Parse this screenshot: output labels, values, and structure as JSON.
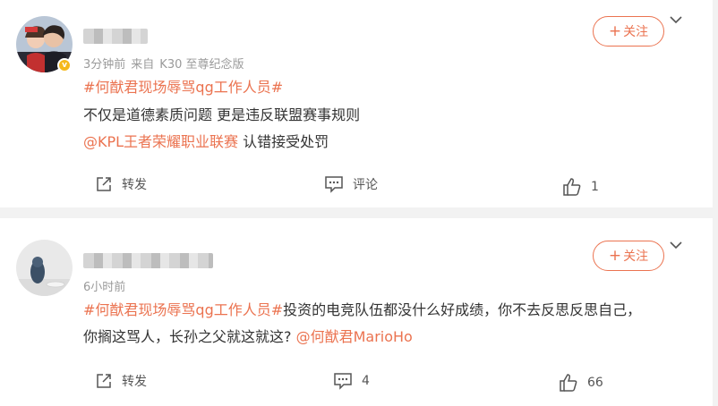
{
  "colors": {
    "accent": "#eb7350",
    "meta": "#9a9a9a",
    "text": "#333333",
    "bg": "#f2f2f2"
  },
  "comments": [
    {
      "follow_label": "关注",
      "follow_plus": "+",
      "time": "3分钟前",
      "source_prefix": "来自",
      "source_device": "K30 至尊纪念版",
      "verified_badge": "v",
      "lines": [
        {
          "hashtag": "#何猷君现场辱骂qg工作人员#",
          "text": "",
          "mention": ""
        },
        {
          "hashtag": "",
          "text": "不仅是道德素质问题 更是违反联盟赛事规则",
          "mention": ""
        },
        {
          "mention": "@KPL王者荣耀职业联赛",
          "text": " 认错接受处罚"
        }
      ],
      "actions": {
        "repost": "转发",
        "comment": "评论",
        "like": "1"
      }
    },
    {
      "follow_label": "关注",
      "follow_plus": "+",
      "time": "6小时前",
      "lines": [
        {
          "hashtag": "#何猷君现场辱骂qg工作人员#",
          "text": "投资的电竞队伍都没什么好成绩，你不去反思反思自己，",
          "mention": ""
        },
        {
          "text": "你搁这骂人，长孙之父就这就这? ",
          "mention": "@何猷君MarioHo"
        }
      ],
      "actions": {
        "repost": "转发",
        "comment": "4",
        "like": "66"
      }
    }
  ]
}
